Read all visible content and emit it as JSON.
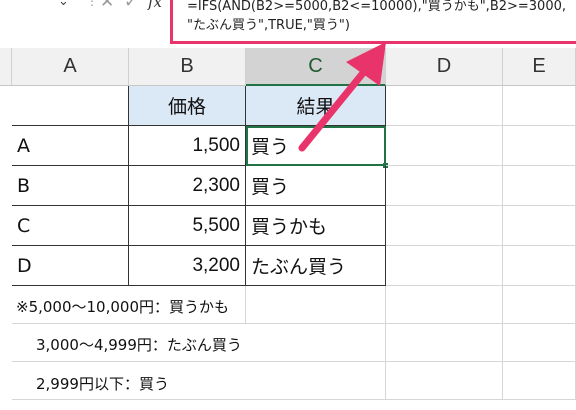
{
  "formula_bar": {
    "line1": "=IFS(AND(B2>=5000,B2<=10000),\"買うかも\",B2>=3000,",
    "line2": "\"たぶん買う\",TRUE,\"買う\")",
    "fx_label": "fx",
    "cancel_glyph": "✕",
    "enter_glyph": "✓",
    "dropdown_glyph": "⌄"
  },
  "columns": [
    "A",
    "B",
    "C",
    "D",
    "E"
  ],
  "table": {
    "headers": [
      "",
      "価格",
      "結果"
    ],
    "rows": [
      {
        "label": "A",
        "price": "1,500",
        "result": "買う"
      },
      {
        "label": "B",
        "price": "2,300",
        "result": "買う"
      },
      {
        "label": "C",
        "price": "5,500",
        "result": "買うかも"
      },
      {
        "label": "D",
        "price": "3,200",
        "result": "たぶん買う"
      }
    ]
  },
  "notes": [
    "※5,000〜10,000円：買うかも",
    "3,000〜4,999円：たぶん買う",
    "2,999円以下：買う"
  ],
  "colors": {
    "accent_arrow": "#e8336b",
    "header_fill": "#dbe8f6",
    "selection": "#217346"
  }
}
